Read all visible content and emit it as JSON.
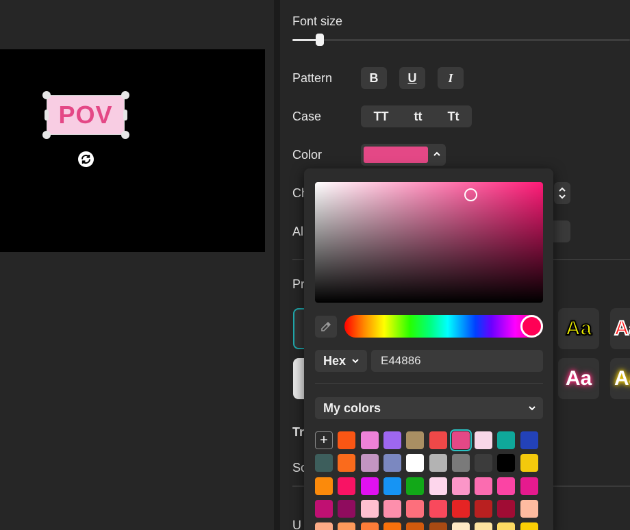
{
  "preview": {
    "text": "POV",
    "text_color": "#e44886",
    "box_color": "#f8cde3"
  },
  "panel": {
    "font_size_label": "Font size",
    "font_size_value_fraction": 0.08,
    "pattern_label": "Pattern",
    "pattern_buttons": [
      "B",
      "U",
      "I"
    ],
    "case_label": "Case",
    "case_options": [
      "TT",
      "tt",
      "Tt"
    ],
    "color_label": "Color",
    "char_label_partial": "Ch",
    "align_label_partial": "Al",
    "presets_label_partial": "Pr",
    "transform_label_partial": "Tr",
    "scale_label_partial": "Sc",
    "under_label_partial": "U",
    "preset_sample": "Aa"
  },
  "picker": {
    "current_hex": "E44886",
    "format_label": "Hex",
    "my_colors_label": "My colors",
    "add_label": "+",
    "hue_color": "#ff0055"
  },
  "swatches": [
    [
      "#fa5614",
      "#ee82d8",
      "#9e67f0",
      "#a98f63",
      "#f04848",
      "#e44886",
      "#f8d7e8",
      "#0fa89a",
      "#2342b8"
    ],
    [
      "#3d5e5c",
      "#fa6b1c",
      "#c395c2",
      "#7b88c0",
      "#ffffff",
      "#b3b3b3",
      "#7a7a7a",
      "#3c3c3c",
      "#000000",
      "#f4c90c"
    ],
    [
      "#fb8a0b",
      "#f81364",
      "#e011f0",
      "#1694f4",
      "#12a818",
      "#fdd6ec",
      "#fb96c8",
      "#fb6cb0",
      "#fb44a4",
      "#e61a8e"
    ],
    [
      "#c01072",
      "#8f0c5e",
      "#ffc0d0",
      "#fd8fac",
      "#fd6f7c",
      "#f9495c",
      "#e52424",
      "#b92020",
      "#a00c34",
      "#febba0"
    ],
    [
      "#fcab86",
      "#fd9a5b",
      "#fc7c38",
      "#f8710c",
      "#d25a0d",
      "#a84a13",
      "#ffeac6",
      "#fde3a0",
      "#fcda62",
      "#fbcf05"
    ]
  ]
}
